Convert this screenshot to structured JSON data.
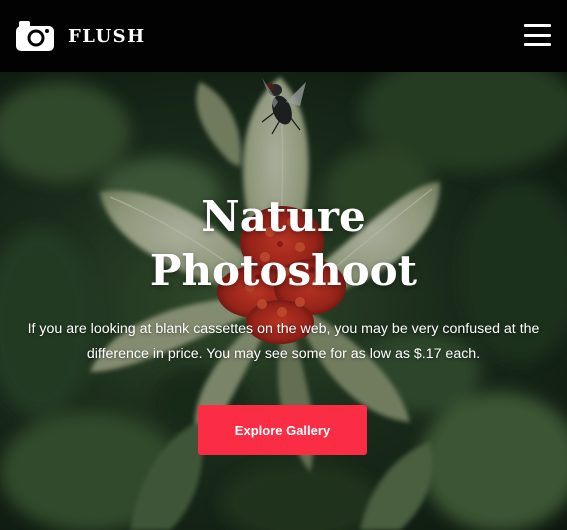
{
  "header": {
    "brand": "FLUSH",
    "logo_icon": "camera-icon",
    "menu_icon": "hamburger-menu-icon"
  },
  "hero": {
    "title_line1": "Nature",
    "title_line2": "Photoshoot",
    "description": "If you are looking at blank cassettes on the web, you may be very confused at the difference in price. You may see some for as low as $.17 each.",
    "cta_label": "Explore Gallery",
    "background_image": "flower-with-fly-photo"
  },
  "colors": {
    "header_bg": "#020202",
    "accent": "#fb2d45",
    "text": "#ffffff",
    "foliage": "#2e4a2c"
  }
}
